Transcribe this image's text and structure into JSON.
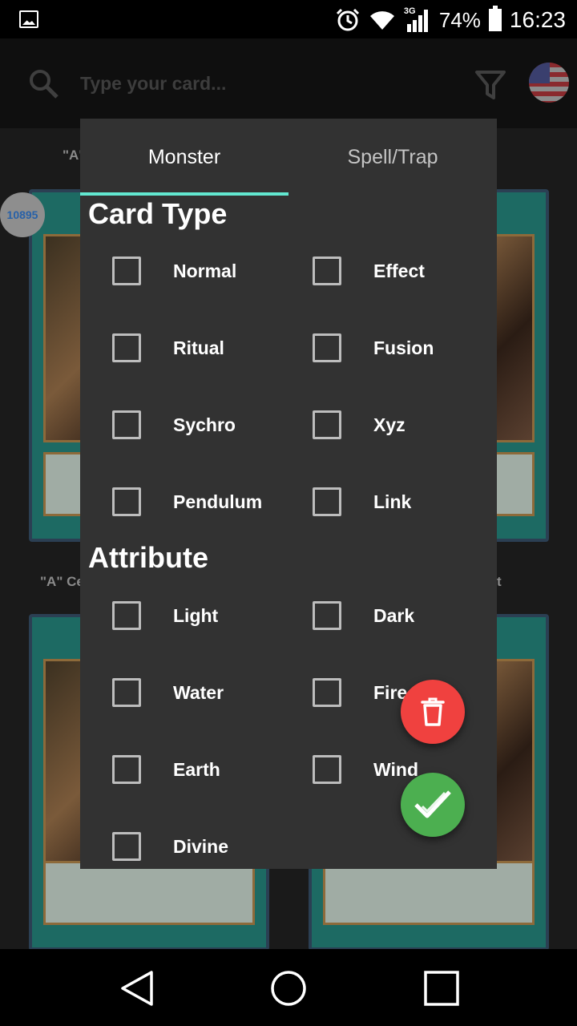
{
  "status_bar": {
    "network": "3G",
    "battery_percent": "74%",
    "time": "16:23",
    "icons": [
      "image-icon",
      "alarm-icon",
      "wifi-icon",
      "signal-icon",
      "battery-icon"
    ]
  },
  "app_bar": {
    "search_placeholder": "Type your card...",
    "icons": [
      "search-icon",
      "filter-icon",
      "us-flag-icon"
    ]
  },
  "background": {
    "card_count": "10895",
    "card_titles": [
      "\"A\"",
      "\"A\" Ce",
      "t"
    ]
  },
  "dialog": {
    "tabs": [
      {
        "label": "Monster",
        "selected": true
      },
      {
        "label": "Spell/Trap",
        "selected": false
      }
    ],
    "card_type": {
      "title": "Card Type",
      "options": [
        "Normal",
        "Effect",
        "Ritual",
        "Fusion",
        "Sychro",
        "Xyz",
        "Pendulum",
        "Link"
      ]
    },
    "attribute": {
      "title": "Attribute",
      "options": [
        "Light",
        "Dark",
        "Water",
        "Fire",
        "Earth",
        "Wind",
        "Divine"
      ]
    }
  },
  "fabs": {
    "delete_icon": "trash-icon",
    "confirm_icon": "check-icon",
    "delete_color": "#f0413f",
    "confirm_color": "#4caf50"
  },
  "nav_bar": {
    "icons": [
      "back-icon",
      "home-icon",
      "recents-icon"
    ]
  },
  "colors": {
    "accent": "#62e8d0",
    "dialog_bg": "#323232"
  }
}
